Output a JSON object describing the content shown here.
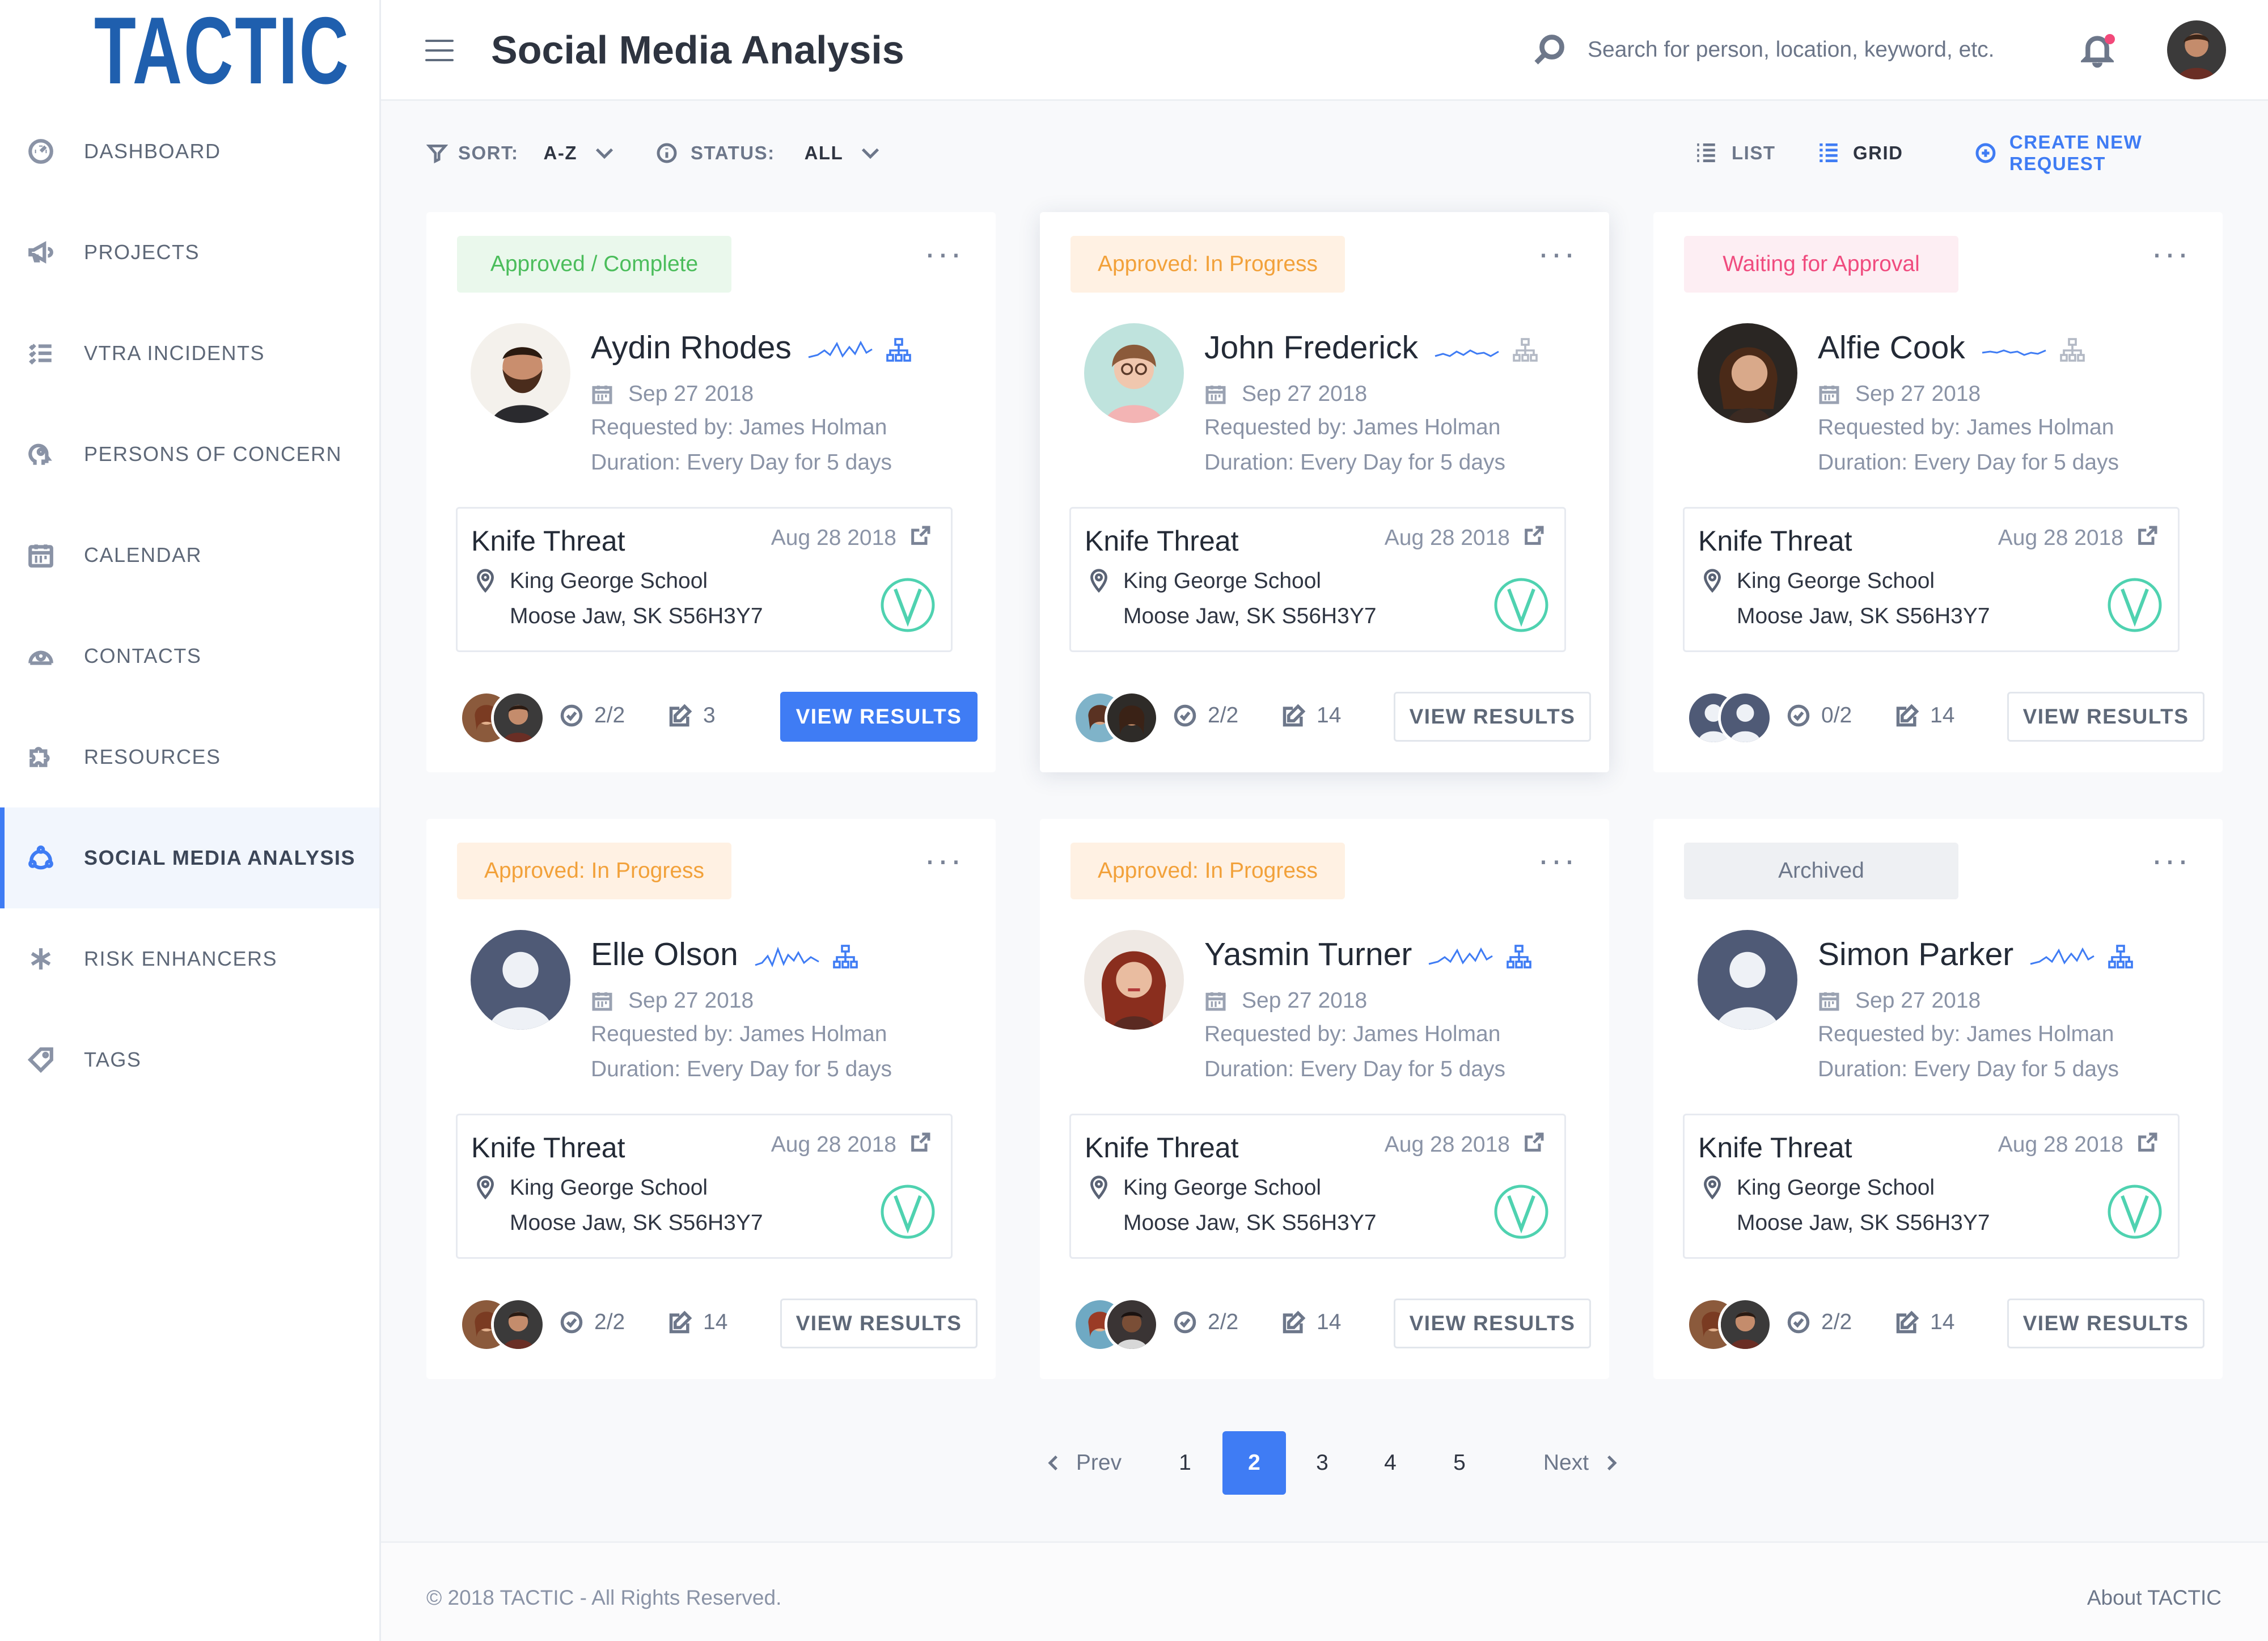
{
  "app": {
    "logo": "TACTIC"
  },
  "colors": {
    "accent": "#3f7cf4",
    "brand": "#1f5fae",
    "complete": "#4bbd5b",
    "progress": "#f2a13a",
    "waiting": "#f04c7f",
    "archived": "#6d778a",
    "verified": "#4fd2b0"
  },
  "sidebar": {
    "items": [
      {
        "label": "DASHBOARD",
        "icon": "gauge-icon"
      },
      {
        "label": "PROJECTS",
        "icon": "megaphone-icon"
      },
      {
        "label": "VTRA INCIDENTS",
        "icon": "checklist-icon"
      },
      {
        "label": "PERSONS OF CONCERN",
        "icon": "head-icon"
      },
      {
        "label": "CALENDAR",
        "icon": "calendar-icon"
      },
      {
        "label": "CONTACTS",
        "icon": "contacts-icon"
      },
      {
        "label": "RESOURCES",
        "icon": "puzzle-icon"
      },
      {
        "label": "SOCIAL MEDIA ANALYSIS",
        "icon": "social-icon",
        "active": true
      },
      {
        "label": "RISK ENHANCERS",
        "icon": "asterisk-icon"
      },
      {
        "label": "TAGS",
        "icon": "tag-icon"
      }
    ]
  },
  "header": {
    "title": "Social Media Analysis",
    "search_placeholder": "Search for person, location, keyword, etc."
  },
  "toolbar": {
    "sort_label": "SORT:",
    "sort_value": "A-Z",
    "status_label": "STATUS:",
    "status_value": "ALL",
    "list_label": "LIST",
    "grid_label": "GRID",
    "create_label": "CREATE NEW REQUEST"
  },
  "cards": [
    {
      "status": "Approved / Complete",
      "status_type": "complete",
      "name": "Aydin Rhodes",
      "date": "Sep 27 2018",
      "requested_by": "Requested by: James Holman",
      "duration": "Duration: Every Day for 5 days",
      "incident_title": "Knife Threat",
      "incident_date": "Aug 28 2018",
      "address_line1": "King George School",
      "address_line2": "Moose Jaw, SK S56H3Y7",
      "checks": "2/2",
      "notes": "3",
      "button_label": "VIEW RESULTS",
      "button_primary": true
    },
    {
      "status": "Approved: In Progress",
      "status_type": "progress",
      "name": "John Frederick",
      "date": "Sep 27 2018",
      "requested_by": "Requested by: James Holman",
      "duration": "Duration: Every Day for 5 days",
      "incident_title": "Knife Threat",
      "incident_date": "Aug 28 2018",
      "address_line1": "King George School",
      "address_line2": "Moose Jaw, SK S56H3Y7",
      "checks": "2/2",
      "notes": "14",
      "button_label": "VIEW RESULTS",
      "button_primary": false
    },
    {
      "status": "Waiting for Approval",
      "status_type": "waiting",
      "name": "Alfie Cook",
      "date": "Sep 27 2018",
      "requested_by": "Requested by: James Holman",
      "duration": "Duration: Every Day for 5 days",
      "incident_title": "Knife Threat",
      "incident_date": "Aug 28 2018",
      "address_line1": "King George School",
      "address_line2": "Moose Jaw, SK S56H3Y7",
      "checks": "0/2",
      "notes": "14",
      "button_label": "VIEW RESULTS",
      "button_primary": false
    },
    {
      "status": "Approved: In Progress",
      "status_type": "progress",
      "name": "Elle Olson",
      "date": "Sep 27 2018",
      "requested_by": "Requested by: James Holman",
      "duration": "Duration: Every Day for 5 days",
      "incident_title": "Knife Threat",
      "incident_date": "Aug 28 2018",
      "address_line1": "King George School",
      "address_line2": "Moose Jaw, SK S56H3Y7",
      "checks": "2/2",
      "notes": "14",
      "button_label": "VIEW RESULTS",
      "button_primary": false
    },
    {
      "status": "Approved: In Progress",
      "status_type": "progress",
      "name": "Yasmin Turner",
      "date": "Sep 27 2018",
      "requested_by": "Requested by: James Holman",
      "duration": "Duration: Every Day for 5 days",
      "incident_title": "Knife Threat",
      "incident_date": "Aug 28 2018",
      "address_line1": "King George School",
      "address_line2": "Moose Jaw, SK S56H3Y7",
      "checks": "2/2",
      "notes": "14",
      "button_label": "VIEW RESULTS",
      "button_primary": false
    },
    {
      "status": "Archived",
      "status_type": "archived",
      "name": "Simon Parker",
      "date": "Sep 27 2018",
      "requested_by": "Requested by: James Holman",
      "duration": "Duration: Every Day for 5 days",
      "incident_title": "Knife Threat",
      "incident_date": "Aug 28 2018",
      "address_line1": "King George School",
      "address_line2": "Moose Jaw, SK S56H3Y7",
      "checks": "2/2",
      "notes": "14",
      "button_label": "VIEW RESULTS",
      "button_primary": false
    }
  ],
  "pagination": {
    "prev_label": "Prev",
    "next_label": "Next",
    "pages": [
      "1",
      "2",
      "3",
      "4",
      "5"
    ],
    "current": "2"
  },
  "footer": {
    "copyright": "© 2018 TACTIC - All Rights Reserved.",
    "about": "About TACTIC"
  }
}
